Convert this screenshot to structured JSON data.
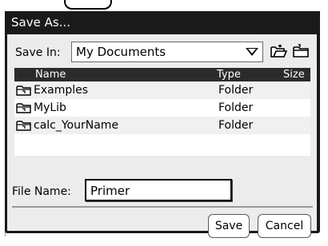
{
  "dialog": {
    "title": "Save As...",
    "save_in_label": "Save In:",
    "location": "My Documents",
    "new_folder_icon": "new-folder-icon",
    "up_folder_icon": "up-folder-icon"
  },
  "table": {
    "columns": [
      "Name",
      "Type",
      "Size"
    ],
    "rows": [
      {
        "name": "Examples",
        "type": "Folder",
        "size": "",
        "icon": "folder-icon"
      },
      {
        "name": "MyLib",
        "type": "Folder",
        "size": "",
        "icon": "folder-icon"
      },
      {
        "name": "calc_YourName",
        "type": "Folder",
        "size": "",
        "icon": "folder-icon"
      }
    ]
  },
  "file_name": {
    "label": "File Name:",
    "value": "Primer"
  },
  "buttons": {
    "save": "Save",
    "cancel": "Cancel"
  },
  "colors": {
    "title_bar": "#1a1a1a",
    "dialog_body": "#ececec",
    "header_bg": "#2b2b2b"
  }
}
